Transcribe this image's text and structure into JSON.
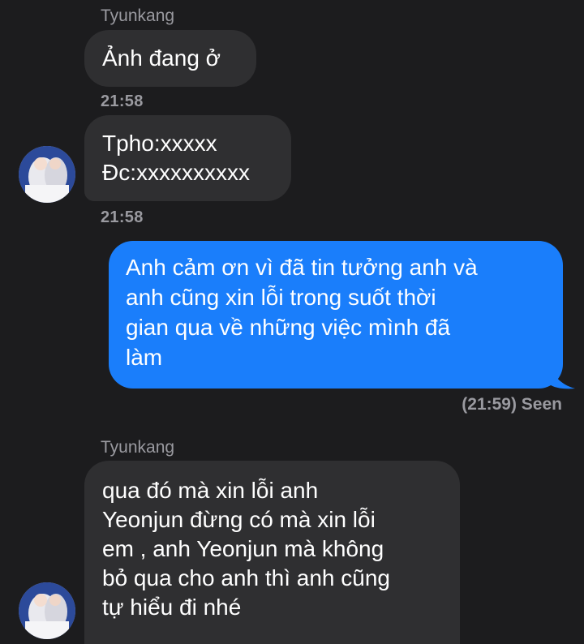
{
  "conversation": {
    "messages": [
      {
        "sender_name": "Tyunkang",
        "text": "Ảnh đang ở",
        "time": "21:58"
      },
      {
        "text": "Tpho:xxxxx\nĐc:xxxxxxxxxx",
        "time": "21:58"
      },
      {
        "text": "Anh cảm ơn vì đã tin tưởng anh và\nanh cũng xin lỗi trong suốt thời\ngian qua về những việc mình đã\nlàm",
        "status": "(21:59) Seen"
      },
      {
        "sender_name": "Tyunkang",
        "text": "qua đó mà xin lỗi anh\nYeonjun đừng có mà xin lỗi\nem , anh Yeonjun mà không\nbỏ qua cho anh thì anh cũng\ntự hiểu đi nhé"
      }
    ]
  },
  "colors": {
    "background": "#1c1c1e",
    "incoming_bubble": "#2f2f31",
    "outgoing_bubble": "#1a7efb",
    "meta_text": "#9a9aa0"
  },
  "icons": [
    "avatar"
  ]
}
